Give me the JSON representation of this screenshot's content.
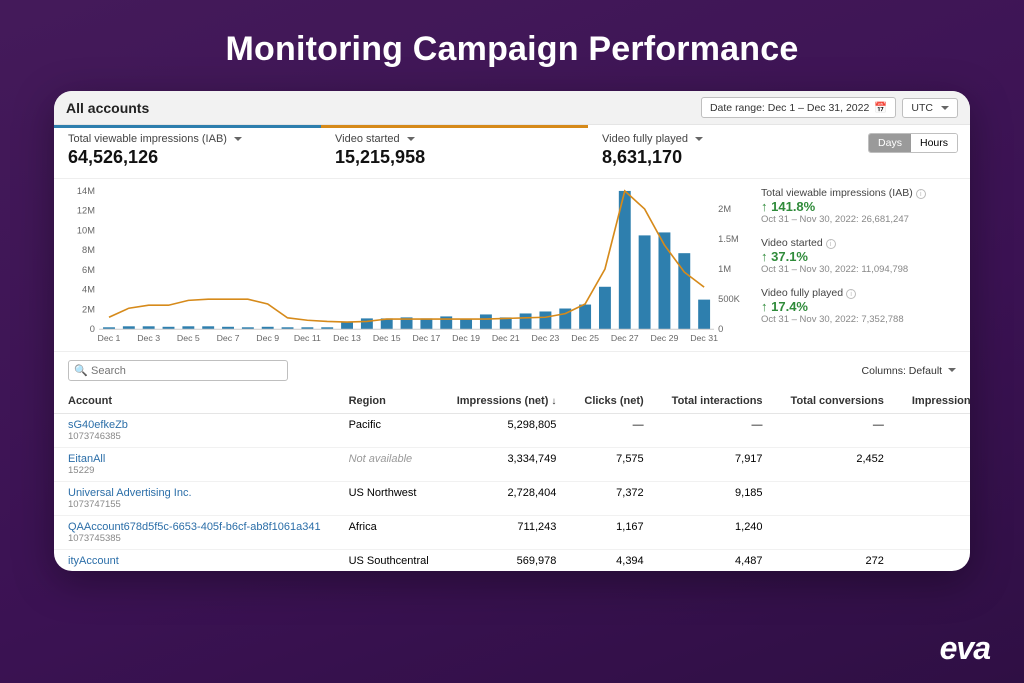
{
  "page": {
    "title": "Monitoring Campaign Performance",
    "brand": "eva"
  },
  "header": {
    "title": "All accounts",
    "date_range_label": "Date range: Dec 1 – Dec 31, 2022",
    "tz_label": "UTC"
  },
  "kpis": [
    {
      "label": "Total viewable impressions (IAB)",
      "value": "64,526,126",
      "accent": "blue"
    },
    {
      "label": "Video started",
      "value": "15,215,958",
      "accent": "orange"
    },
    {
      "label": "Video fully played",
      "value": "8,631,170",
      "accent": "none"
    }
  ],
  "toggle": {
    "days": "Days",
    "hours": "Hours",
    "active": "days"
  },
  "side_metrics": [
    {
      "label": "Total viewable impressions (IAB)",
      "pct": "141.8%",
      "prev": "Oct 31 – Nov 30, 2022: 26,681,247"
    },
    {
      "label": "Video started",
      "pct": "37.1%",
      "prev": "Oct 31 – Nov 30, 2022: 11,094,798"
    },
    {
      "label": "Video fully played",
      "pct": "17.4%",
      "prev": "Oct 31 – Nov 30, 2022: 7,352,788"
    }
  ],
  "search": {
    "placeholder": "Search"
  },
  "columns_btn": "Columns: Default",
  "table": {
    "headers": {
      "account": "Account",
      "region": "Region",
      "impressions": "Impressions (net)",
      "clicks": "Clicks (net)",
      "interactions": "Total interactions",
      "conversions": "Total conversions",
      "dwell": "Impressions with dwell"
    },
    "rows": [
      {
        "name": "sG40efkeZb",
        "id": "1073746385",
        "region": "Pacific",
        "impressions": "5,298,805",
        "clicks": "—",
        "interactions": "—",
        "conversions": "—"
      },
      {
        "name": "EitanAll",
        "id": "15229",
        "region": "Not available",
        "region_muted": true,
        "impressions": "3,334,749",
        "clicks": "7,575",
        "interactions": "7,917",
        "conversions": "2,452"
      },
      {
        "name": "Universal Advertising Inc.",
        "id": "1073747155",
        "region": "US Northwest",
        "impressions": "2,728,404",
        "clicks": "7,372",
        "interactions": "9,185",
        "conversions": ""
      },
      {
        "name": "QAAccount678d5f5c-6653-405f-b6cf-ab8f1061a341",
        "id": "1073745385",
        "region": "Africa",
        "impressions": "711,243",
        "clicks": "1,167",
        "interactions": "1,240",
        "conversions": ""
      },
      {
        "name": "ityAccount",
        "id": "",
        "region": "US Southcentral",
        "impressions": "569,978",
        "clicks": "4,394",
        "interactions": "4,487",
        "conversions": "272"
      }
    ]
  },
  "chart_data": {
    "type": "bar+line",
    "x": [
      "Dec 1",
      "Dec 2",
      "Dec 3",
      "Dec 4",
      "Dec 5",
      "Dec 6",
      "Dec 7",
      "Dec 8",
      "Dec 9",
      "Dec 10",
      "Dec 11",
      "Dec 12",
      "Dec 13",
      "Dec 14",
      "Dec 15",
      "Dec 16",
      "Dec 17",
      "Dec 18",
      "Dec 19",
      "Dec 20",
      "Dec 21",
      "Dec 22",
      "Dec 23",
      "Dec 24",
      "Dec 25",
      "Dec 26",
      "Dec 27",
      "Dec 28",
      "Dec 29",
      "Dec 30",
      "Dec 31"
    ],
    "bars": {
      "name": "Total viewable impressions (IAB)",
      "unit": "count",
      "values": [
        200000,
        300000,
        300000,
        250000,
        300000,
        300000,
        250000,
        200000,
        250000,
        200000,
        200000,
        200000,
        700000,
        1100000,
        1100000,
        1200000,
        1100000,
        1300000,
        1000000,
        1500000,
        1200000,
        1600000,
        1800000,
        2100000,
        2500000,
        4300000,
        14000000,
        9500000,
        9800000,
        7700000,
        3000000
      ],
      "ylim": [
        0,
        14000000
      ],
      "ticks": [
        0,
        2000000,
        4000000,
        6000000,
        8000000,
        10000000,
        12000000,
        14000000
      ],
      "tick_labels": [
        "0",
        "2M",
        "4M",
        "6M",
        "8M",
        "10M",
        "12M",
        "14M"
      ]
    },
    "line": {
      "name": "Video started",
      "unit": "count",
      "values": [
        200000,
        350000,
        400000,
        400000,
        480000,
        500000,
        500000,
        500000,
        420000,
        190000,
        150000,
        130000,
        120000,
        130000,
        170000,
        170000,
        170000,
        170000,
        170000,
        170000,
        180000,
        190000,
        200000,
        260000,
        420000,
        1000000,
        2300000,
        2000000,
        1400000,
        950000,
        700000
      ],
      "ylim": [
        0,
        2300000
      ],
      "ticks": [
        0,
        500000,
        1000000,
        1500000,
        2000000
      ],
      "tick_labels": [
        "0",
        "500K",
        "1M",
        "1.5M",
        "2M"
      ]
    },
    "x_tick_labels": [
      "Dec 1",
      "Dec 3",
      "Dec 5",
      "Dec 7",
      "Dec 9",
      "Dec 11",
      "Dec 13",
      "Dec 15",
      "Dec 17",
      "Dec 19",
      "Dec 21",
      "Dec 23",
      "Dec 25",
      "Dec 27",
      "Dec 29",
      "Dec 31"
    ]
  }
}
